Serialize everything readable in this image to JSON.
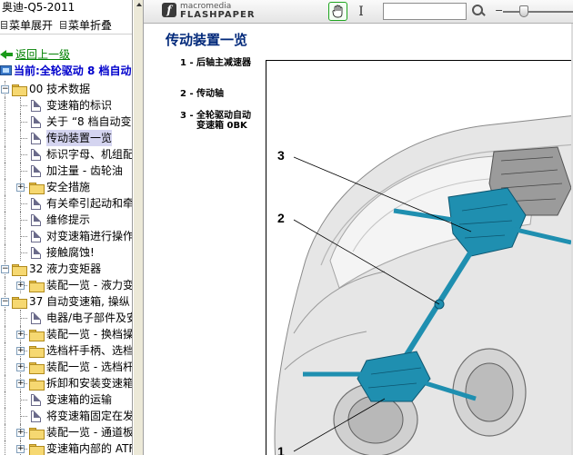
{
  "app": {
    "title": "奥迪-Q5-2011"
  },
  "toolbar": {
    "expand_label": "菜单展开",
    "collapse_label": "菜单折叠"
  },
  "tree": {
    "back_label": "返回上一级",
    "current_label": "当前:全轮驱动  8 档自动",
    "items": [
      {
        "label": "00 技术数据",
        "type": "folder",
        "level": 0,
        "expanded": true
      },
      {
        "label": "变速箱的标识",
        "type": "doc",
        "level": 1
      },
      {
        "label": "关于 “8 档自动变",
        "type": "doc",
        "level": 1
      },
      {
        "label": "传动装置一览",
        "type": "doc",
        "level": 1,
        "selected": true
      },
      {
        "label": "标识字母、机组配",
        "type": "doc",
        "level": 1
      },
      {
        "label": "加注量 - 齿轮油",
        "type": "doc",
        "level": 1
      },
      {
        "label": "安全措施",
        "type": "folder",
        "level": 1,
        "expanded": false
      },
      {
        "label": "有关牵引起动和牵",
        "type": "doc",
        "level": 1
      },
      {
        "label": "维修提示",
        "type": "doc",
        "level": 1
      },
      {
        "label": "对变速箱进行操作",
        "type": "doc",
        "level": 1
      },
      {
        "label": "接触腐蚀!",
        "type": "doc",
        "level": 1
      },
      {
        "label": "32 液力变矩器",
        "type": "folder",
        "level": 0,
        "expanded": true
      },
      {
        "label": "装配一览 - 液力变",
        "type": "folder",
        "level": 1,
        "expanded": false
      },
      {
        "label": "37 自动变速箱, 操纵",
        "type": "folder",
        "level": 0,
        "expanded": true
      },
      {
        "label": "电器/电子部件及安",
        "type": "doc",
        "level": 1
      },
      {
        "label": "装配一览 - 换档操",
        "type": "folder",
        "level": 1,
        "expanded": false
      },
      {
        "label": "选档杆手柄、选档",
        "type": "folder",
        "level": 1,
        "expanded": false
      },
      {
        "label": "装配一览 - 选档杆",
        "type": "folder",
        "level": 1,
        "expanded": false
      },
      {
        "label": "拆卸和安装变速箱",
        "type": "folder",
        "level": 1,
        "expanded": false
      },
      {
        "label": "变速箱的运输",
        "type": "doc",
        "level": 1
      },
      {
        "label": "将变速箱固定在发",
        "type": "doc",
        "level": 1
      },
      {
        "label": "装配一览 - 通道板",
        "type": "folder",
        "level": 1,
        "expanded": false
      },
      {
        "label": "变速箱内部的 ATF",
        "type": "folder",
        "level": 1,
        "expanded": false
      }
    ]
  },
  "viewer": {
    "brand_top": "macromedia",
    "brand_bottom": "FLASHPAPER",
    "hand_tool": "hand-icon",
    "text_tool": "text-select-icon",
    "search_value": "",
    "zoom_level": 0.3
  },
  "document": {
    "title": "传动装置一览",
    "legend": [
      {
        "num": "1 -",
        "text": "后轴主减速器"
      },
      {
        "num": "2 -",
        "text": "传动轴"
      },
      {
        "num": "3 -",
        "text": "全轮驱动自动变速箱 0BK"
      }
    ],
    "callouts": [
      "3",
      "2",
      "1"
    ]
  },
  "colors": {
    "title_blue": "#00287a",
    "back_green": "#008000",
    "current_blue": "#0000cc",
    "drivetrain": "#1f8fb0"
  }
}
